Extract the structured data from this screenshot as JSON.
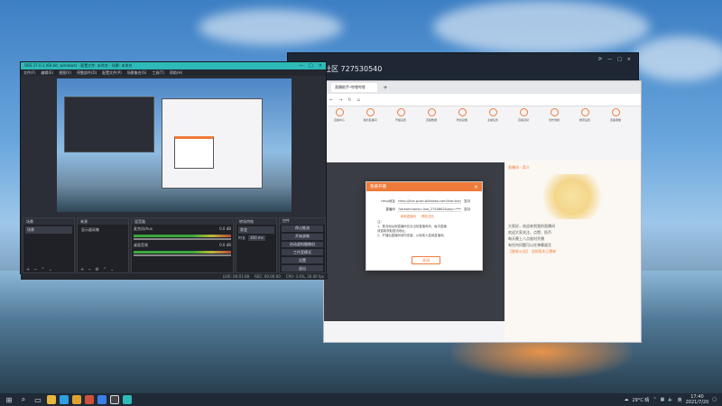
{
  "desktop": {
    "qq_window": {
      "title": "社区 727530540",
      "right_labels": [
        "ᐅ",
        "—",
        "□",
        "×"
      ]
    },
    "taskbar": {
      "tray": {
        "weather": "29°C 晴",
        "ime": "英",
        "time": "17:40",
        "date": "2021/7/20"
      }
    }
  },
  "obs": {
    "title": "OBS 27.0.1 (64-bit, windows) - 配置文件: 未命名 - 场景: 未命名",
    "menu": [
      "文件(F)",
      "编辑(E)",
      "视图(V)",
      "停靠部件(D)",
      "配置文件(P)",
      "场景集合(S)",
      "工具(T)",
      "帮助(H)"
    ],
    "docks": {
      "scenes": {
        "header": "场景",
        "items": [
          "场景"
        ]
      },
      "sources": {
        "header": "来源",
        "items": [
          "显示器采集"
        ]
      },
      "mixer": {
        "header": "混音器",
        "tracks": [
          {
            "name": "麦克风/Aux",
            "db": "0.0 dB"
          },
          {
            "name": "桌面音频",
            "db": "0.0 dB"
          }
        ]
      },
      "transitions": {
        "header": "转场特效",
        "type": "渐变",
        "duration_label": "时长",
        "duration": "300 ms"
      },
      "controls": {
        "header": "控件",
        "buttons": [
          "停止推流",
          "开始录制",
          "启动虚拟摄像机",
          "工作室模式",
          "设置",
          "退出"
        ]
      }
    },
    "status": {
      "live": "LIVE: 00:01:08",
      "rec": "REC: 00:00:00",
      "cpu": "CPU: 3.6%, 30.00 fps"
    }
  },
  "browser": {
    "tab_label": "直播助手-哔哩哔哩",
    "nav": [
      "←",
      "→",
      "↻",
      "⌂"
    ],
    "icons": [
      "直播中心",
      "我的直播间",
      "开播设置",
      "直播数据",
      "粉丝勋章",
      "主播任务",
      "直播活动",
      "创作激励",
      "推流设置",
      "直播课堂"
    ],
    "side_panel": {
      "lines": [
        "直播间 · 简介",
        "大家好，欢迎来到我的直播间",
        "欢迎大家关注、点赞、投币",
        "每天晚上八点准时开播",
        "有任何问题可以在弹幕留言",
        "【更新公告】 当前版本已更新"
      ]
    },
    "modal": {
      "title": "我要开播",
      "close": "×",
      "server_label": "rtmp地址",
      "server_value": "rtmp://live-push.bilivideo.com/live-bvc/",
      "server_copy": "复制",
      "key_label": "直播码",
      "key_value": "?streamname=live_2740862&key=******",
      "key_copy": "复制",
      "links": [
        "刷新直播码",
        "帮助文档"
      ],
      "notes": [
        "注：",
        "1、推流地址和直播码仅对当前直播有效，每次直播",
        "请重新获取推流地址。",
        "2、开播后直播码请勿泄露，以免他人盗用直播间。"
      ],
      "button": "关闭"
    }
  }
}
